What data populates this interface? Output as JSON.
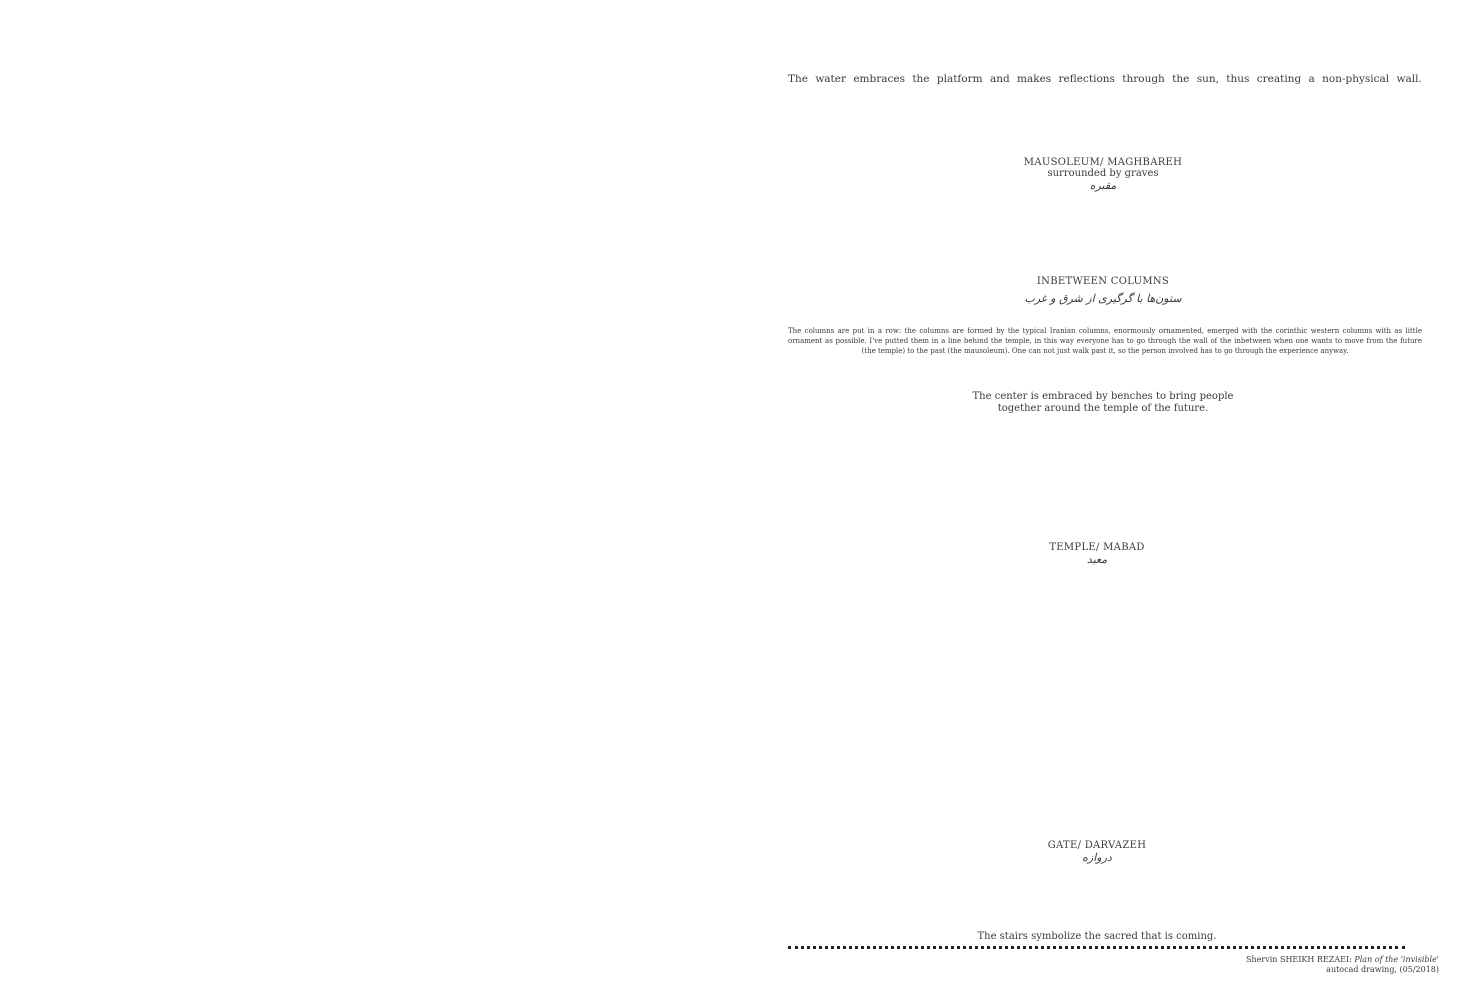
{
  "intro": {
    "words": [
      "The",
      "water",
      "embraces",
      "the",
      "platform",
      "and",
      "makes",
      "reflections",
      "through",
      "the",
      "sun,",
      "thus",
      "creating",
      "a",
      "non-physical",
      "wall."
    ]
  },
  "mausoleum": {
    "title": "MAUSOLEUM/ MAGHBAREH",
    "subtitle": "surrounded by graves",
    "persian": "مقبره"
  },
  "columns": {
    "title": "INBETWEEN COLUMNS",
    "persian": "ستون‌ها با گرگیری از شرق و غرب",
    "description": "The columns are put in a row: the columns are formed by the typical Iranian columns, enormously ornamented, emerged with the corinthic western columns with as little ornament as possible. I've putted them in a line behind the temple, in this way everyone has to go through the wall of the inbetween when one wants to move from the future (the temple) to the past (the mausoleum). One can not just walk past it, so the person involved has to go through the experience anyway."
  },
  "center_note": {
    "line1": "The center is embraced by benches to bring people",
    "line2": "together around the temple of the future."
  },
  "temple": {
    "title": "TEMPLE/ MABAD",
    "persian": "معبد"
  },
  "gate": {
    "title": "GATE/ DARVAZEH",
    "persian": "دروازه"
  },
  "stairs_note": "The stairs symbolize the sacred that is coming.",
  "caption": {
    "author": "Shervin SHEIKH REZAEI:",
    "work": "Plan of the 'invisible'",
    "line2": "autocad drawing, (05/2018)"
  }
}
